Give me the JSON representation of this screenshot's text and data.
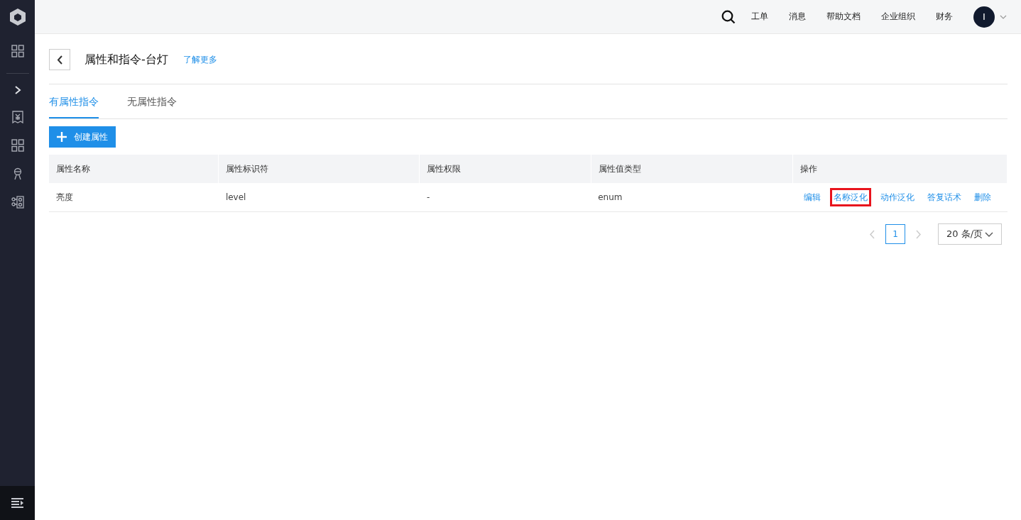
{
  "sidebar": {
    "items": [
      {
        "kind": "grid"
      },
      {
        "kind": "divider"
      },
      {
        "kind": "chevron"
      },
      {
        "kind": "receipt"
      },
      {
        "kind": "grid"
      },
      {
        "kind": "person"
      },
      {
        "kind": "flow"
      }
    ]
  },
  "top_bar": {
    "links": [
      "工单",
      "消息",
      "帮助文档",
      "企业组织",
      "财务"
    ],
    "avatar": "I"
  },
  "header": {
    "title": "属性和指令-台灯",
    "learn_more": "了解更多"
  },
  "tabs": [
    {
      "label": "有属性指令",
      "selected": true
    },
    {
      "label": "无属性指令",
      "selected": false
    }
  ],
  "create_button": "创建属性",
  "table": {
    "columns": [
      "属性名称",
      "属性标识符",
      "属性权限",
      "属性值类型",
      "操作"
    ],
    "rows": [
      {
        "cells": [
          "亮度",
          "level",
          "-",
          "enum"
        ],
        "actions": [
          {
            "label": "编辑",
            "highlighted": false
          },
          {
            "label": "名称泛化",
            "highlighted": true
          },
          {
            "label": "动作泛化",
            "highlighted": false
          },
          {
            "label": "答复话术",
            "highlighted": false
          },
          {
            "label": "删除",
            "highlighted": false
          }
        ]
      }
    ]
  },
  "pagination": {
    "pages": [
      {
        "label": "1",
        "selected": true
      }
    ],
    "page_size": "20 条/页"
  }
}
